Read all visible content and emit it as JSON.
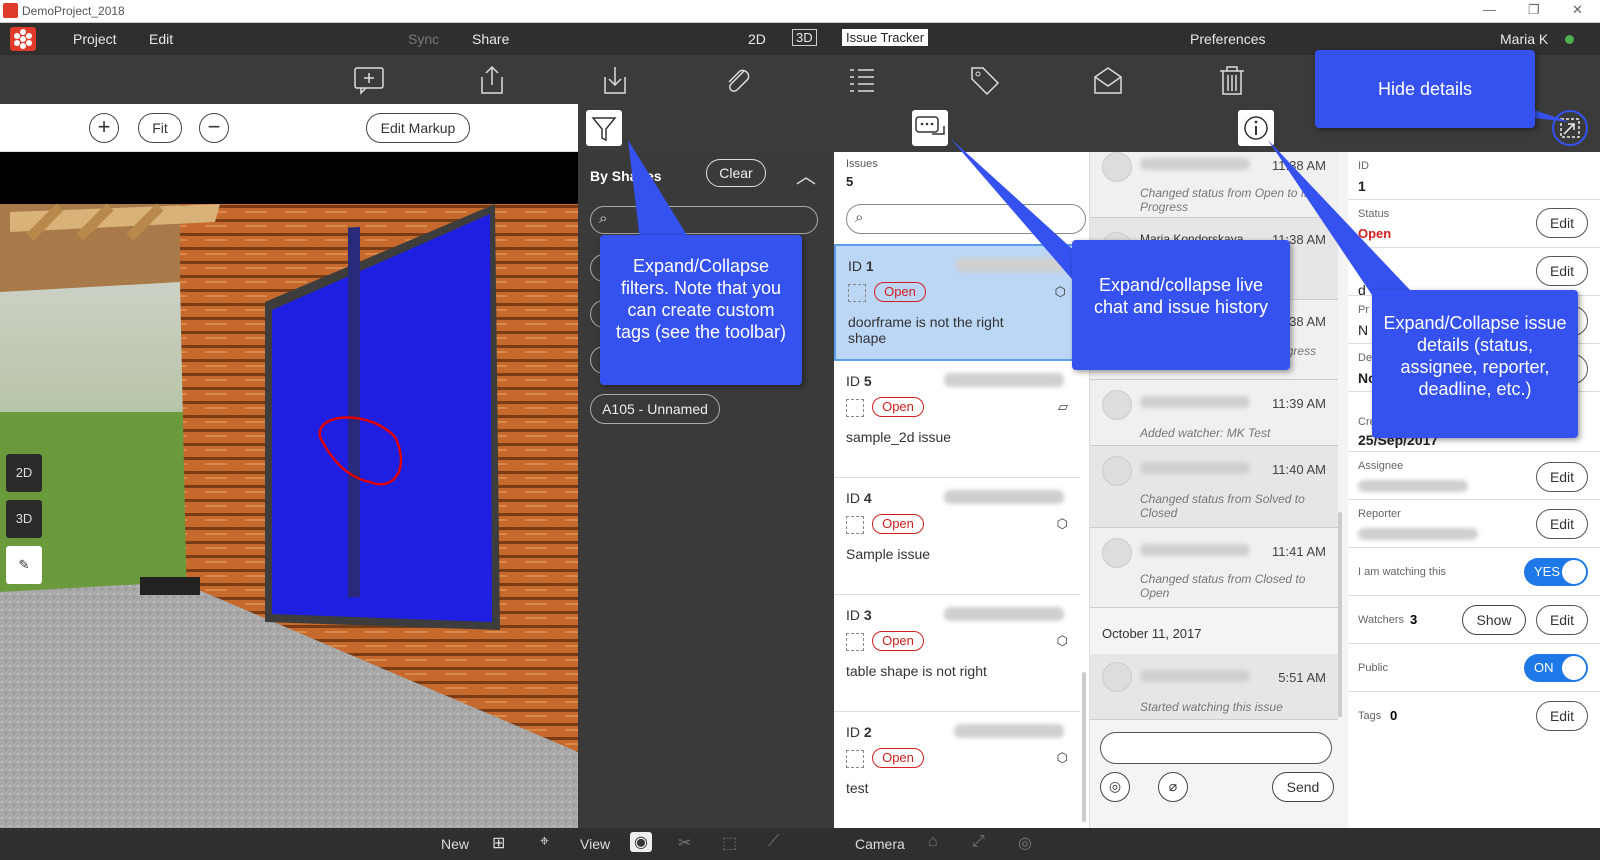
{
  "window": {
    "title": "DemoProject_2018",
    "minimize": "—",
    "restore": "❐",
    "close": "✕"
  },
  "menu": {
    "project": "Project",
    "edit": "Edit",
    "sync": "Sync",
    "share": "Share",
    "view2d": "2D",
    "view3d": "3D",
    "issue_tracker": "Issue Tracker",
    "preferences": "Preferences",
    "user": "Maria K"
  },
  "toolbar": {
    "icons": [
      "add-comment-icon",
      "upload-icon",
      "download-icon",
      "attach-icon",
      "checklist-icon",
      "tag-icon",
      "mail-icon",
      "trash-icon"
    ]
  },
  "viewer": {
    "fit": "Fit",
    "edit_markup": "Edit Markup",
    "side": {
      "b2d": "2D",
      "b3d": "3D"
    }
  },
  "filters": {
    "by_shapes": "By Shapes",
    "clear": "Clear",
    "tag": "A105 - Unnamed"
  },
  "issues": {
    "label": "Issues",
    "count": "5",
    "open_label": "Open",
    "items": [
      {
        "id_label": "ID",
        "id": "1",
        "desc": "doorframe is not the right shape"
      },
      {
        "id_label": "ID",
        "id": "5",
        "desc": "sample_2d issue"
      },
      {
        "id_label": "ID",
        "id": "4",
        "desc": "Sample issue"
      },
      {
        "id_label": "ID",
        "id": "3",
        "desc": "table shape is not right"
      },
      {
        "id_label": "ID",
        "id": "2",
        "desc": "test"
      }
    ]
  },
  "chat": {
    "messages": [
      {
        "time": "11:38 AM",
        "text": "Changed status from Open to In Progress"
      },
      {
        "time": "11:38 AM",
        "name": "Maria Kondorskaya",
        "text": ""
      },
      {
        "time": "11:38 AM",
        "text": "Changed status from In Progress to Solved"
      },
      {
        "time": "11:39 AM",
        "text": "Added watcher: MK Test"
      },
      {
        "time": "11:40 AM",
        "text": "Changed status from Solved to Closed"
      },
      {
        "time": "11:41 AM",
        "text": "Changed status from Closed to Open"
      },
      {
        "time": "5:51 AM",
        "text": "Started watching this issue"
      }
    ],
    "date_sep": "October 11, 2017",
    "send": "Send"
  },
  "details": {
    "id_label": "ID",
    "id": "1",
    "status_label": "Status",
    "status": "Open",
    "created_label": "Created",
    "created": "25/Sep/2017",
    "assignee_label": "Assignee",
    "reporter_label": "Reporter",
    "watching_label": "I am watching this",
    "watching": "YES",
    "watchers_label": "Watchers",
    "watchers": "3",
    "show": "Show",
    "public_label": "Public",
    "public": "ON",
    "tags_label": "Tags",
    "tags": "0",
    "edit": "Edit",
    "partial_d": "d",
    "partial_pr": "Pr",
    "partial_n": "N",
    "partial_de": "De",
    "partial_no": "No"
  },
  "bottom": {
    "new": "New",
    "view": "View",
    "camera": "Camera"
  },
  "callouts": {
    "hide": "Hide details",
    "filters": "Expand/Collapse filters. Note that you can create custom tags (see the toolbar)",
    "chat": "Expand/collapse live chat and issue history",
    "details": "Expand/Collapse issue details (status, assignee, reporter, deadline, etc.)"
  }
}
